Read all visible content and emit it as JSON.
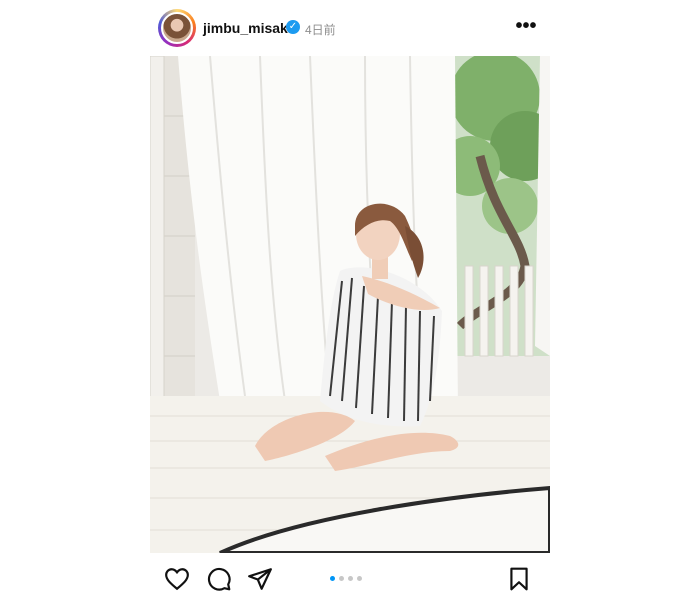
{
  "post": {
    "username": "jimbu_misaki",
    "verified_icon": "verified-badge-icon",
    "time": "4日前",
    "more_icon": "more-options-icon",
    "carousel": {
      "count": 4,
      "active_index": 0
    },
    "actions": {
      "like_icon": "heart-icon",
      "comment_icon": "comment-icon",
      "share_icon": "send-icon",
      "save_icon": "bookmark-icon"
    }
  },
  "colors": {
    "accent": "#0095f6",
    "verified": "#1d9bf0",
    "muted": "#8e8e8e"
  }
}
